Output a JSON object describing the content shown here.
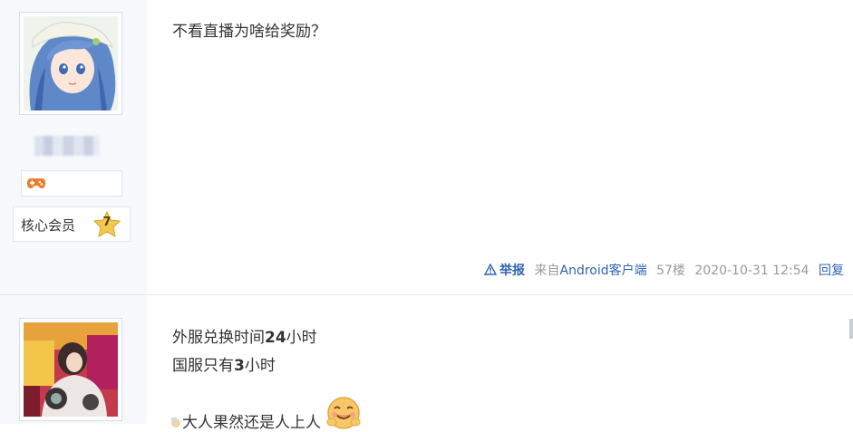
{
  "post1": {
    "text": "不看直播为啥给奖励？",
    "member_label": "核心会员",
    "level": "7",
    "tail": {
      "report": "举报",
      "source_prefix": "来自",
      "source_app": "Android客户端",
      "floor": "57楼",
      "timestamp": "2020-10-31 12:54",
      "reply": "回复"
    }
  },
  "post2": {
    "line1_a": "外服兑换时间",
    "line1_num": "24",
    "line1_b": "小时",
    "line2_a": "国服只有",
    "line2_num": "3",
    "line2_b": "小时",
    "line3": "大人果然还是人上人"
  },
  "icons": {
    "report": "warning-triangle-icon",
    "badge": "gamepad-icon",
    "level": "star-badge-icon",
    "emoji": "smiling-face-emoji-icon"
  },
  "colors": {
    "link": "#2d64b3",
    "sidebar_bg": "#f6f8fc",
    "star": "#f2c14a"
  }
}
